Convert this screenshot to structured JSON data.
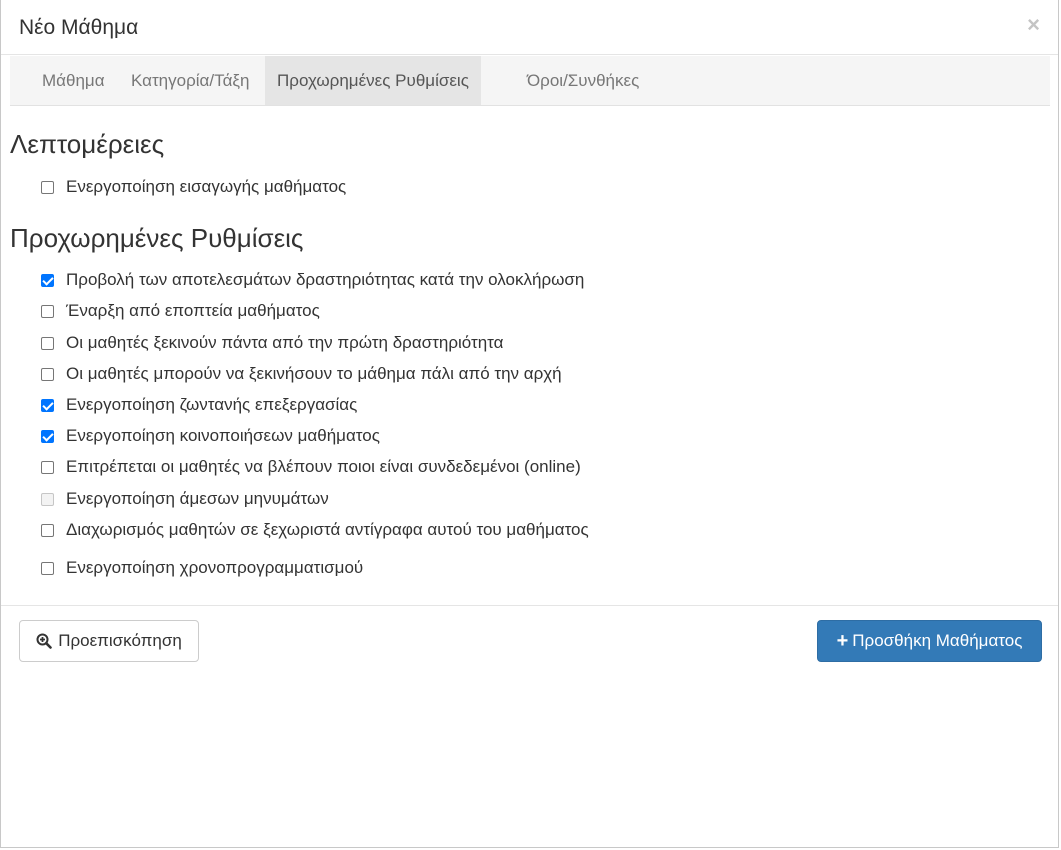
{
  "modal": {
    "title": "Νέο Μάθημα",
    "close_glyph": "×"
  },
  "tabs": [
    {
      "label": "Μάθημα",
      "active": false
    },
    {
      "label": "Κατηγορία/Τάξη",
      "active": false
    },
    {
      "label": "Προχωρημένες Ρυθμίσεις",
      "active": true
    },
    {
      "label": "Όροι/Συνθήκες",
      "active": false
    }
  ],
  "details": {
    "heading": "Λεπτομέρειες",
    "options": [
      {
        "label": "Ενεργοποίηση εισαγωγής μαθήματος",
        "checked": false,
        "disabled": false
      }
    ]
  },
  "advanced": {
    "heading": "Προχωρημένες Ρυθμίσεις",
    "options": [
      {
        "label": "Προβολή των αποτελεσμάτων δραστηριότητας κατά την ολοκλήρωση",
        "checked": true,
        "disabled": false
      },
      {
        "label": "Έναρξη από εποπτεία μαθήματος",
        "checked": false,
        "disabled": false
      },
      {
        "label": "Οι μαθητές ξεκινούν πάντα από την πρώτη δραστηριότητα",
        "checked": false,
        "disabled": false
      },
      {
        "label": "Οι μαθητές μπορούν να ξεκινήσουν το μάθημα πάλι από την αρχή",
        "checked": false,
        "disabled": false
      },
      {
        "label": "Ενεργοποίηση ζωντανής επεξεργασίας",
        "checked": true,
        "disabled": false
      },
      {
        "label": "Ενεργοποίηση κοινοποιήσεων μαθήματος",
        "checked": true,
        "disabled": false
      },
      {
        "label": "Επιτρέπεται οι μαθητές να βλέπουν ποιοι είναι συνδεδεμένοι (online)",
        "checked": false,
        "disabled": false
      },
      {
        "label": "Ενεργοποίηση άμεσων μηνυμάτων",
        "checked": false,
        "disabled": true
      },
      {
        "label": "Διαχωρισμός μαθητών σε ξεχωριστά αντίγραφα αυτού του μαθήματος",
        "checked": false,
        "disabled": false
      },
      {
        "label": "Ενεργοποίηση χρονοπρογραμματισμού",
        "checked": false,
        "disabled": false
      }
    ]
  },
  "footer": {
    "preview_label": "Προεπισκόπηση",
    "preview_icon": "zoom-in-icon",
    "add_label": "Προσθήκη Μαθήματος",
    "add_icon": "plus-icon",
    "primary_color": "#337ab7"
  }
}
